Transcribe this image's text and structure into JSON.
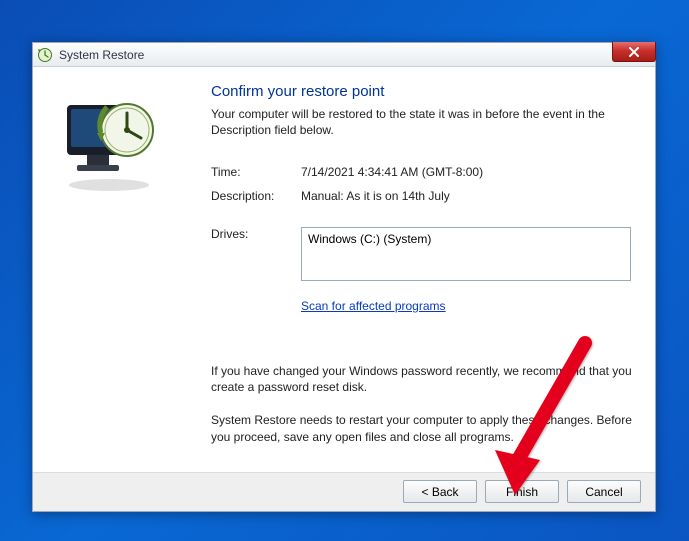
{
  "window": {
    "title": "System Restore"
  },
  "heading": "Confirm your restore point",
  "intro": "Your computer will be restored to the state it was in before the event in the Description field below.",
  "fields": {
    "time_label": "Time:",
    "time_value": "7/14/2021 4:34:41 AM (GMT-8:00)",
    "desc_label": "Description:",
    "desc_value": "Manual: As it is on 14th July",
    "drives_label": "Drives:",
    "drives_value": "Windows (C:) (System)"
  },
  "scan_link": "Scan for affected programs",
  "note_password": "If you have changed your Windows password recently, we recommend that you create a password reset disk.",
  "note_restart": "System Restore needs to restart your computer to apply these changes. Before you proceed, save any open files and close all programs.",
  "buttons": {
    "back": "< Back",
    "finish": "Finish",
    "cancel": "Cancel"
  }
}
